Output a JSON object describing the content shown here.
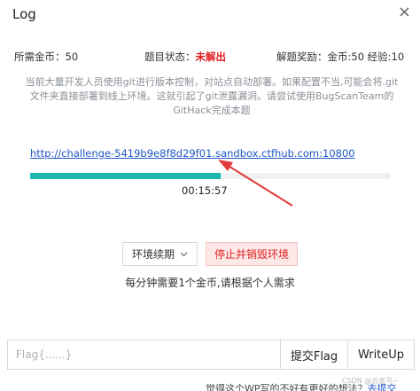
{
  "dialog": {
    "title": "Log",
    "close_glyph": "×"
  },
  "info": {
    "gold_label": "所需金币：50",
    "status_label": "题目状态：",
    "status_value": "未解出",
    "status_color": "#e02020",
    "reward_label": "解题奖励：金币:50 经验:10"
  },
  "description": "当前大量开发人员使用git进行版本控制，对站点自动部署。如果配置不当,可能会将.git文件夹直接部署到线上环境。这就引起了git泄露漏洞。请尝试使用BugScanTeam的GitHack完成本题",
  "challenge": {
    "url": "http://challenge-5419b9e8f8d29f01.sandbox.ctfhub.com:10800",
    "progress": 0.53,
    "progress_color": "#1bb8b0",
    "timer": "00:15:57"
  },
  "controls": {
    "extend_label": "环境续期",
    "extend_icon": "chevron-down-icon",
    "stop_label": "停止并销毁环境",
    "note": "每分钟需要1个金币,请根据个人需求"
  },
  "flag": {
    "placeholder": "Flag{......}",
    "submit_label": "提交Flag",
    "writeup_label": "WriteUp"
  },
  "footer": {
    "text": "觉得这个WP写的不好有更好的想法？",
    "link": "去提交",
    "watermark": "CSDN @云雀鸟~"
  }
}
